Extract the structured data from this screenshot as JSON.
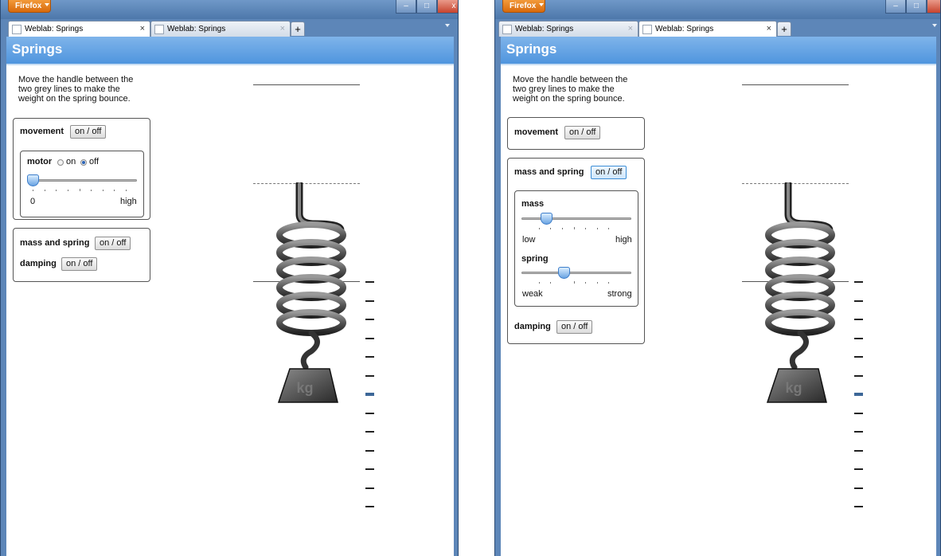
{
  "windows": [
    {
      "firefox_label": "Firefox",
      "tabs": [
        {
          "title": "Weblab: Springs",
          "active": true
        },
        {
          "title": "Weblab: Springs",
          "active": false
        }
      ],
      "new_tab": "+",
      "app_title": "Springs",
      "instructions": "Move the handle between the two grey lines to make the weight on the spring bounce.",
      "movement": {
        "label": "movement",
        "button": "on / off"
      },
      "motor": {
        "label": "motor",
        "on_label": "on",
        "off_label": "off",
        "selected": "off",
        "slider_value": 0,
        "min_label": "0",
        "max_label": "high"
      },
      "mass_and_spring": {
        "label": "mass and spring",
        "button": "on / off"
      },
      "damping": {
        "label": "damping",
        "button": "on / off"
      },
      "scale_highlight_index": 6,
      "window_controls": {
        "min": "–",
        "max": "□",
        "close": "x"
      }
    },
    {
      "firefox_label": "Firefox",
      "tabs": [
        {
          "title": "Weblab: Springs",
          "active": false
        },
        {
          "title": "Weblab: Springs",
          "active": true
        }
      ],
      "new_tab": "+",
      "app_title": "Springs",
      "instructions": "Move the handle between the two grey lines to make the weight on the spring bounce.",
      "movement": {
        "label": "movement",
        "button": "on / off"
      },
      "mass_and_spring": {
        "label": "mass and spring",
        "button": "on / off"
      },
      "mass": {
        "label": "mass",
        "min_label": "low",
        "max_label": "high",
        "slider_value": 0.2
      },
      "spring": {
        "label": "spring",
        "min_label": "weak",
        "max_label": "strong",
        "slider_value": 0.4
      },
      "damping": {
        "label": "damping",
        "button": "on / off"
      },
      "scale_highlight_index": 6,
      "window_controls": {
        "min": "–",
        "max": "□",
        "close": "x"
      }
    }
  ],
  "weight_label": "kg",
  "colors": {
    "title_bar": "#5d86b8",
    "app_bar": "#4f95de",
    "firefox_button": "#e07a1c",
    "slider_thumb": "#6aa4e3",
    "scale_highlight": "#3d6798"
  }
}
